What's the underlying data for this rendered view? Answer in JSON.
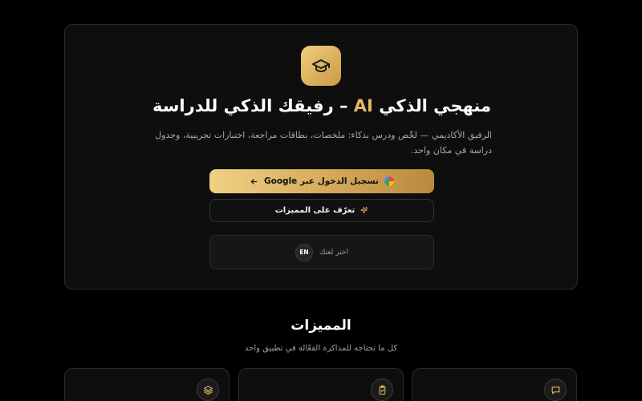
{
  "hero": {
    "title_part1": "منهجي الذكي ",
    "title_ai": "AI",
    "title_part2": " – رفيقك الذكي للدراسة",
    "subtitle": "الرفيق الأكاديمي — لخّص ودرس بذكاء: ملخصات، بطاقات مراجعة، اختبارات تجريبية، وجدول دراسة في مكان واحد.",
    "google_button_label": "تسجيل الدخول عبر Google",
    "features_button_label": "تعرّف على المميزات",
    "language_label": "اختر لغتك",
    "language_code": "EN"
  },
  "features": {
    "title": "المميزات",
    "subtitle": "كل ما تحتاجه للمذاكرة الفعّالة في تطبيق واحد"
  },
  "icons": {
    "logo": "graduation-cap-icon",
    "google": "google-icon",
    "arrow": "arrow-left-icon",
    "sparkles": "sparkles-icon",
    "card1": "chat-bubble-icon",
    "card2": "clipboard-check-icon",
    "card3": "layers-icon"
  },
  "colors": {
    "accent_gold": "#e4b866",
    "background": "#000000",
    "card_background": "#0e0e0e"
  }
}
